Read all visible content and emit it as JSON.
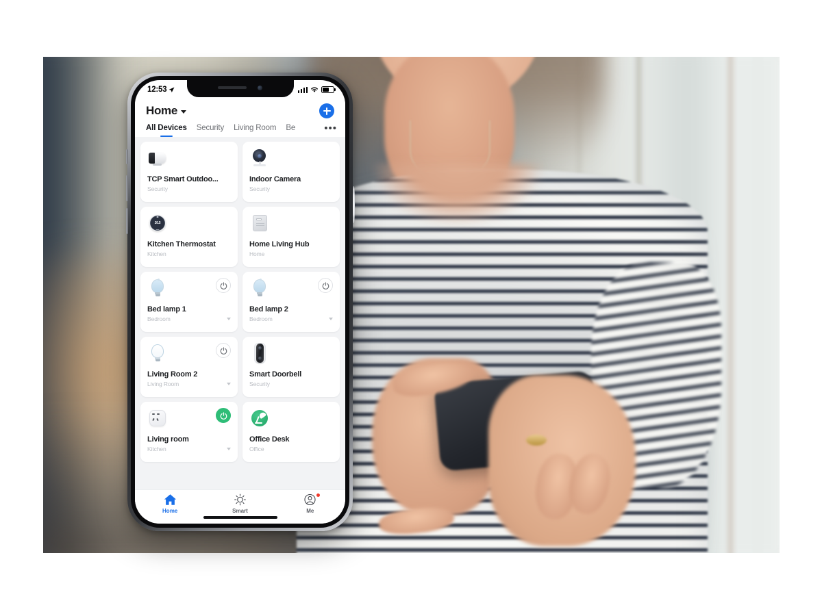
{
  "status_bar": {
    "time": "12:53",
    "location_icon": "location-arrow-icon",
    "signal_icon": "cellular-signal-icon",
    "wifi_icon": "wifi-icon",
    "battery_icon": "battery-icon",
    "battery_level": 60
  },
  "header": {
    "home_label": "Home",
    "chevron_icon": "chevron-down-icon",
    "add_icon": "plus-icon"
  },
  "tabs": {
    "items": [
      {
        "label": "All Devices",
        "active": true
      },
      {
        "label": "Security",
        "active": false
      },
      {
        "label": "Living Room",
        "active": false
      },
      {
        "label": "Be",
        "active": false
      }
    ],
    "overflow_label": "•••"
  },
  "devices": [
    {
      "name": "TCP Smart Outdoo...",
      "room": "Security",
      "icon": "outdoor-camera-icon",
      "has_power": false,
      "power_on": false,
      "has_chevron": false
    },
    {
      "name": "Indoor Camera",
      "room": "Security",
      "icon": "indoor-camera-icon",
      "has_power": false,
      "power_on": false,
      "has_chevron": false
    },
    {
      "name": "Kitchen Thermostat",
      "room": "Kitchen",
      "icon": "thermostat-icon",
      "temperature": "20.5",
      "has_power": false,
      "power_on": false,
      "has_chevron": false
    },
    {
      "name": "Home Living Hub",
      "room": "Home",
      "icon": "hub-icon",
      "has_power": false,
      "power_on": false,
      "has_chevron": false
    },
    {
      "name": "Bed lamp 1",
      "room": "Bedroom",
      "icon": "bulb-icon",
      "has_power": true,
      "power_on": false,
      "has_chevron": true
    },
    {
      "name": "Bed lamp 2",
      "room": "Bedroom",
      "icon": "bulb-icon",
      "has_power": true,
      "power_on": false,
      "has_chevron": true
    },
    {
      "name": "Living Room 2",
      "room": "Living Room",
      "icon": "bulb-off-icon",
      "has_power": true,
      "power_on": false,
      "has_chevron": true
    },
    {
      "name": "Smart Doorbell",
      "room": "Security",
      "icon": "doorbell-icon",
      "has_power": false,
      "power_on": false,
      "has_chevron": false
    },
    {
      "name": "Living room",
      "room": "Kitchen",
      "icon": "smart-plug-icon",
      "has_power": true,
      "power_on": true,
      "has_chevron": true
    },
    {
      "name": "Office Desk",
      "room": "Office",
      "icon": "desk-lamp-icon",
      "has_power": false,
      "power_on": false,
      "has_chevron": false
    }
  ],
  "tabbar": {
    "items": [
      {
        "label": "Home",
        "icon": "home-icon",
        "active": true,
        "badge": false
      },
      {
        "label": "Smart",
        "icon": "sun-icon",
        "active": false,
        "badge": false
      },
      {
        "label": "Me",
        "icon": "account-icon",
        "active": false,
        "badge": true
      }
    ]
  },
  "colors": {
    "accent_blue": "#1a6fe8",
    "active_green": "#2ebd77",
    "badge_red": "#f0392b",
    "grid_bg": "#f2f3f5"
  }
}
